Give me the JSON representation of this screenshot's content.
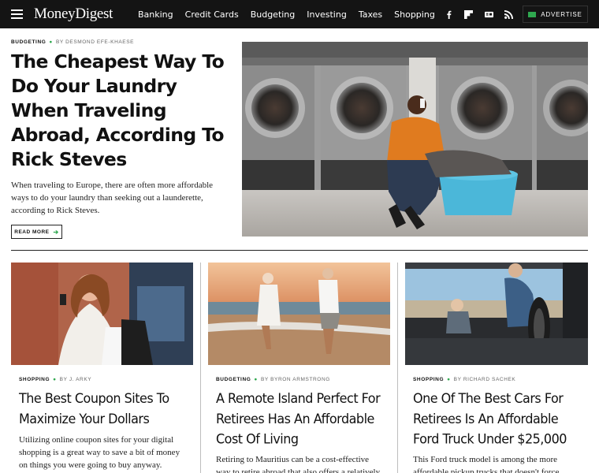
{
  "header": {
    "logo": "MoneyDigest",
    "nav": [
      "Banking",
      "Credit Cards",
      "Budgeting",
      "Investing",
      "Taxes",
      "Shopping"
    ],
    "social_icons": [
      "facebook-icon",
      "flipboard-icon",
      "google-news-icon",
      "rss-icon"
    ],
    "advertise_label": "ADVERTISE"
  },
  "hero": {
    "category": "BUDGETING",
    "byline": "BY DESMOND EFE-KHAESE",
    "title": "The Cheapest Way To Do Your Laundry When Traveling Abroad, According To Rick Steves",
    "description": "When traveling to Europe, there are often more affordable ways to do your laundry than seeking out a launderette, according to Rick Steves.",
    "read_more": "READ MORE"
  },
  "cards": [
    {
      "category": "SHOPPING",
      "byline": "BY J. ARKY",
      "title": "The Best Coupon Sites To Maximize Your Dollars",
      "description": "Utilizing online coupon sites for your digital shopping is a great way to save a bit of money on things you were going to buy anyway."
    },
    {
      "category": "BUDGETING",
      "byline": "BY BYRON ARMSTRONG",
      "title": "A Remote Island Perfect For Retirees Has An Affordable Cost Of Living",
      "description": "Retiring to Mauritius can be a cost-effective way to retire abroad that also offers a relatively"
    },
    {
      "category": "SHOPPING",
      "byline": "BY RICHARD SACHEK",
      "title": "One Of The Best Cars For Retirees Is An Affordable Ford Truck Under $25,000",
      "description": "This Ford truck model is among the more affordable pickup trucks that doesn't force buyers"
    }
  ],
  "colors": {
    "header_bg": "#141414",
    "accent_green": "#2fa84f"
  }
}
